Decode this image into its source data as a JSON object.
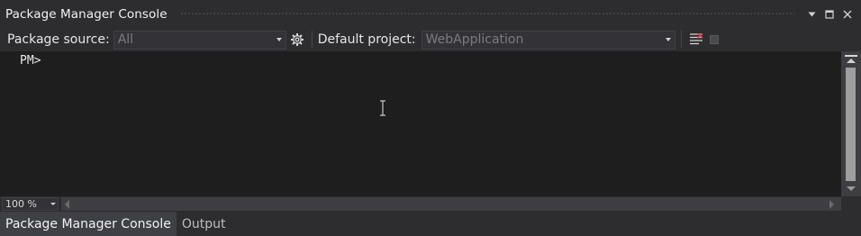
{
  "window": {
    "title": "Package Manager Console",
    "buttons": {
      "dropdown": "▾",
      "maximize": "□",
      "close": "✕"
    }
  },
  "toolbar": {
    "package_source_label": "Package source:",
    "package_source_value": "All",
    "default_project_label": "Default project:",
    "default_project_value": "WebApplication"
  },
  "console": {
    "prompt": "PM>"
  },
  "status": {
    "zoom": "100 %"
  },
  "tabs": [
    {
      "label": "Package Manager Console",
      "active": true
    },
    {
      "label": "Output",
      "active": false
    }
  ],
  "icons": {
    "settings": "gear-icon",
    "clear": "clear-console-icon",
    "stop": "stop-icon"
  }
}
